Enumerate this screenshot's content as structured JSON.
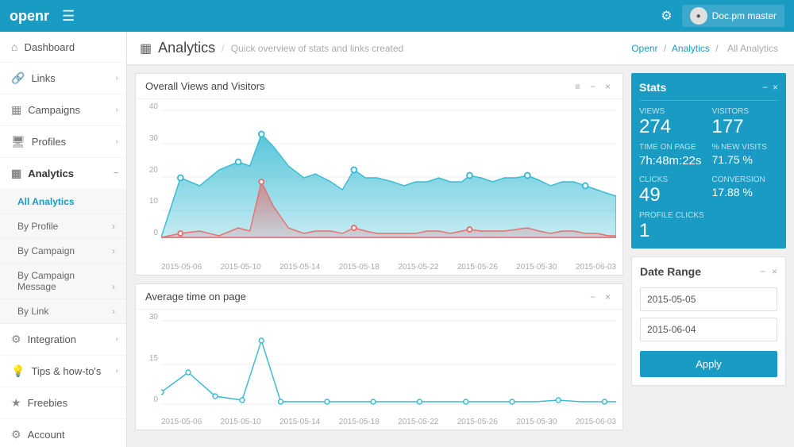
{
  "header": {
    "logo": "openr",
    "hamburger": "☰",
    "search_icon": "🔍",
    "user": "Doc.pm master"
  },
  "sidebar": {
    "items": [
      {
        "label": "Dashboard",
        "icon": "⌂",
        "id": "dashboard"
      },
      {
        "label": "Links",
        "icon": "🔗",
        "id": "links"
      },
      {
        "label": "Campaigns",
        "icon": "▦",
        "id": "campaigns"
      },
      {
        "label": "Profiles",
        "icon": "🖥",
        "id": "profiles"
      },
      {
        "label": "Analytics",
        "icon": "▦",
        "id": "analytics",
        "active": true
      }
    ],
    "analytics_sub": [
      {
        "label": "All Analytics",
        "active": true
      },
      {
        "label": "By Profile"
      },
      {
        "label": "By Campaign"
      },
      {
        "label": "By Campaign Message"
      },
      {
        "label": "By Link"
      }
    ],
    "bottom_items": [
      {
        "label": "Integration",
        "icon": "⚙"
      },
      {
        "label": "Tips & how-to's",
        "icon": "💡"
      },
      {
        "label": "Freebies",
        "icon": "★"
      },
      {
        "label": "Account",
        "icon": "⚙"
      }
    ]
  },
  "page": {
    "icon": "▦",
    "title": "Analytics",
    "subtitle": "Quick overview of stats and links created",
    "breadcrumb": [
      "Openr",
      "Analytics",
      "All Analytics"
    ]
  },
  "stats": {
    "title": "Stats",
    "views_label": "VIEWS",
    "views_value": "274",
    "visitors_label": "VISITORS",
    "visitors_value": "177",
    "time_label": "TIME ON PAGE",
    "time_value": "7h:48m:22s",
    "new_visits_label": "% NEW VISITS",
    "new_visits_value": "71.75 %",
    "clicks_label": "CLICKS",
    "clicks_value": "49",
    "conversion_label": "CONVERSION",
    "conversion_value": "17.88 %",
    "profile_clicks_label": "PROFILE CLICKS",
    "profile_clicks_value": "1"
  },
  "chart1": {
    "title": "Overall Views and Visitors",
    "x_labels": [
      "2015-05-06",
      "2015-05-10",
      "2015-05-14",
      "2015-05-18",
      "2015-05-22",
      "2015-05-26",
      "2015-05-30",
      "2015-06-03"
    ],
    "y_labels": [
      "40",
      "30",
      "20",
      "10",
      "0"
    ]
  },
  "chart2": {
    "title": "Average time on page",
    "x_labels": [
      "2015-05-06",
      "2015-05-10",
      "2015-05-14",
      "2015-05-18",
      "2015-05-22",
      "2015-05-26",
      "2015-05-30",
      "2015-06-03"
    ],
    "y_labels": [
      "30",
      "15",
      "0"
    ]
  },
  "date_range": {
    "title": "Date Range",
    "start": "2015-05-05",
    "end": "2015-06-04",
    "apply_label": "Apply"
  }
}
